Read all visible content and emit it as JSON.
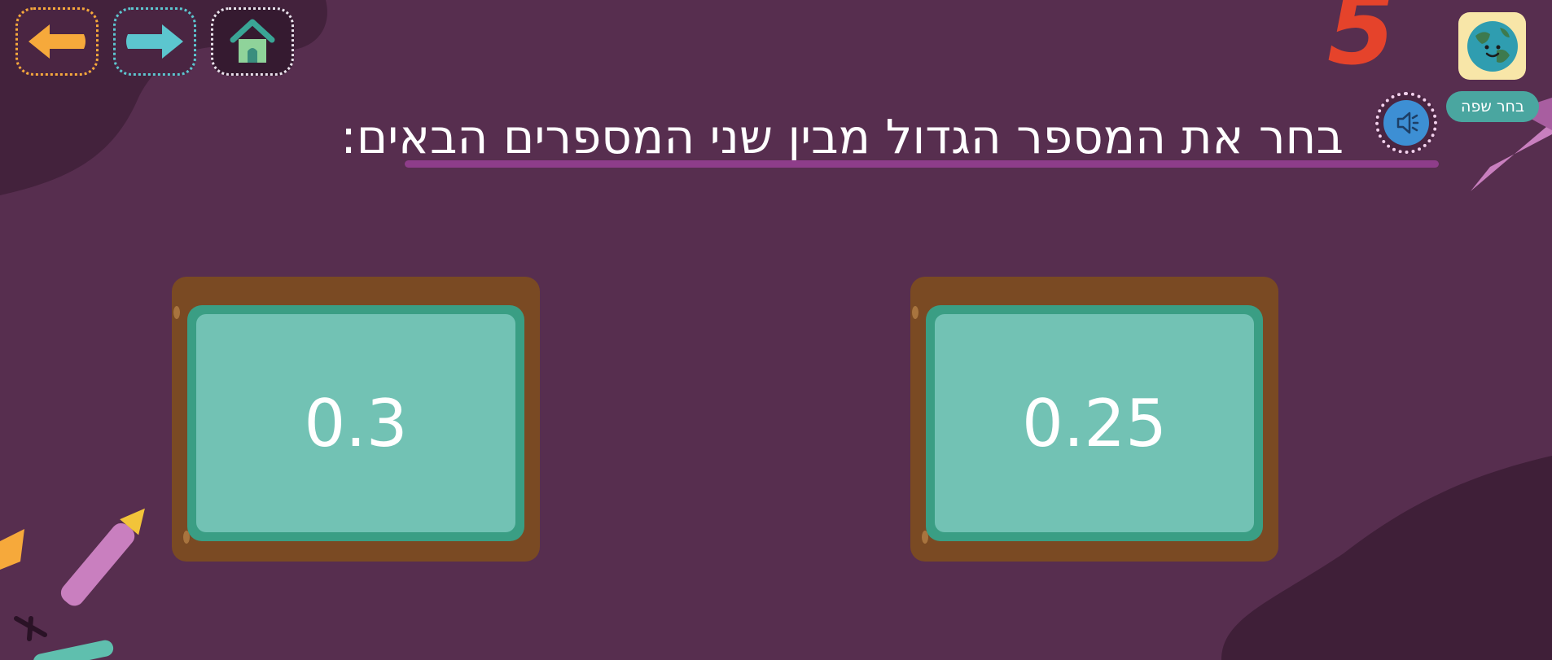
{
  "nav": {
    "back_icon": "arrow-left-icon",
    "forward_icon": "arrow-right-icon",
    "home_icon": "house-icon"
  },
  "question": {
    "text": "בחר את המספר הגדול מבין שני המספרים הבאים:",
    "audio_icon": "speaker-icon"
  },
  "language": {
    "icon": "globe-icon",
    "label": "בחר שפה"
  },
  "decoration": {
    "number": "5"
  },
  "options": [
    {
      "value": "0.3"
    },
    {
      "value": "0.25"
    }
  ],
  "colors": {
    "background": "#572e4f",
    "card_frame": "#7a4a23",
    "card_face": "#72c2b4",
    "accent_orange": "#f6a93b",
    "accent_cyan": "#5cc6cf"
  }
}
